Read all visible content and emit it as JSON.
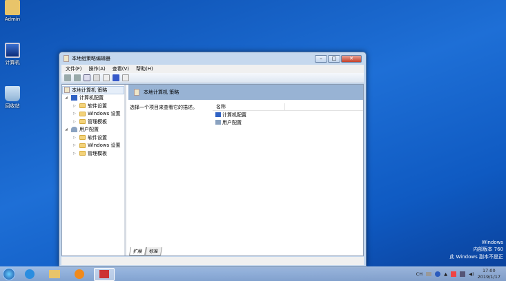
{
  "desktop": {
    "icons": [
      {
        "label": "Admin"
      },
      {
        "label": "计算机"
      },
      {
        "label": "回收站"
      }
    ],
    "watermark": [
      "Windows",
      "内部版本 760",
      "此 Windows 副本不是正"
    ]
  },
  "window": {
    "title": "本地组策略编辑器",
    "menu": [
      "文件(F)",
      "操作(A)",
      "查看(V)",
      "帮助(H)"
    ],
    "tree": [
      {
        "label": "本地计算机 策略",
        "level": 0
      },
      {
        "label": "计算机配置",
        "level": 1
      },
      {
        "label": "软件设置",
        "level": 2
      },
      {
        "label": "Windows 设置",
        "level": 2
      },
      {
        "label": "管理模板",
        "level": 2
      },
      {
        "label": "用户配置",
        "level": 1
      },
      {
        "label": "软件设置",
        "level": 2
      },
      {
        "label": "Windows 设置",
        "level": 2
      },
      {
        "label": "管理模板",
        "level": 2
      }
    ],
    "header": "本地计算机 策略",
    "description": "选择一个项目来查看它的描述。",
    "column": "名称",
    "items": [
      "计算机配置",
      "用户配置"
    ],
    "tabs": [
      "扩展",
      "标准"
    ]
  },
  "taskbar": {
    "tray": {
      "lang": "CH",
      "time": "17:00",
      "date": "2019/1/17"
    }
  }
}
